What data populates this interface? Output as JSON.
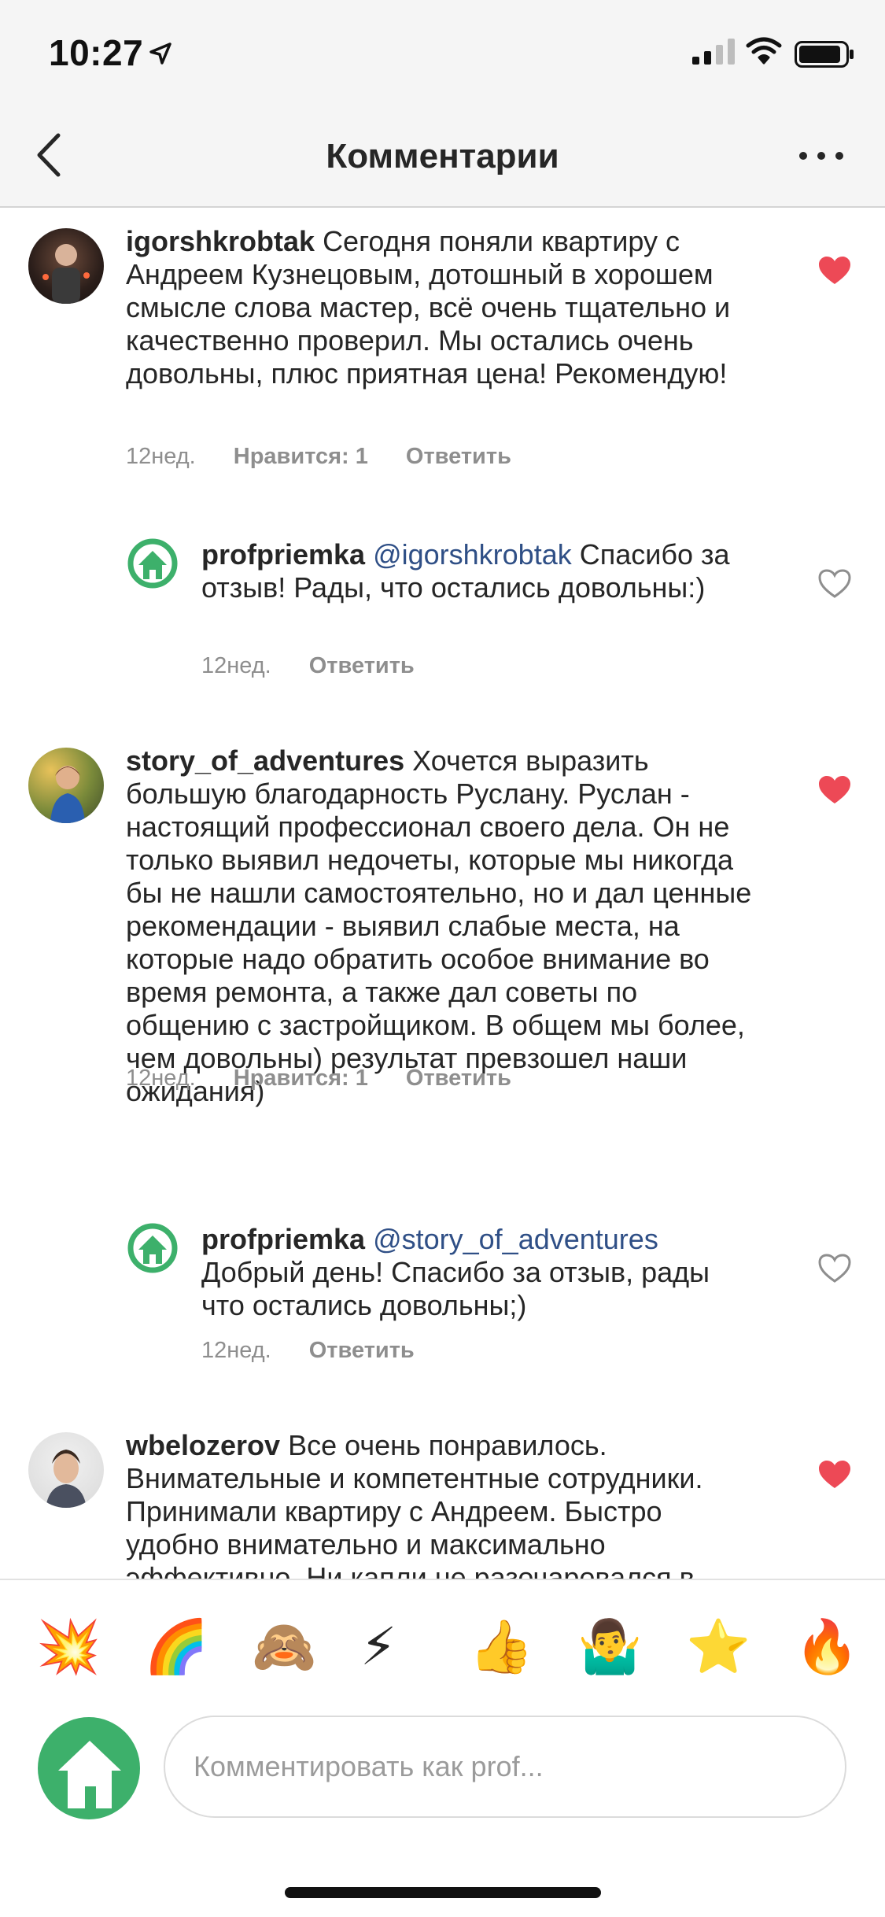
{
  "status_bar": {
    "time": "10:27"
  },
  "header": {
    "title": "Комментарии"
  },
  "comments": [
    {
      "username": "igorshkrobtak",
      "text": "Сегодня поняли квартиру с Андреем Кузнецовым, дотошный в хорошем смысле слова мастер, всё очень тщательно и качественно проверил. Мы остались очень довольны, плюс приятная цена! Рекомендую!",
      "time": "12нед.",
      "likes": "Нравится: 1",
      "reply": "Ответить",
      "liked": true,
      "reply_comment": {
        "username": "profpriemka",
        "mention": "@igorshkrobtak",
        "text": "Спасибо за отзыв! Рады, что остались довольны:)",
        "time": "12нед.",
        "reply": "Ответить",
        "liked": false
      }
    },
    {
      "username": "story_of_adventures",
      "text": "Хочется выразить большую благодарность Руслану. Руслан - настоящий профессионал своего дела. Он не только выявил недочеты, которые мы никогда бы не нашли самостоятельно, но и дал ценные рекомендации - выявил слабые места, на которые надо обратить особое внимание во время ремонта, а также дал советы по общению с застройщиком. В общем мы более, чем довольны) результат превзошел наши ожидания)",
      "time": "12нед.",
      "likes": "Нравится: 1",
      "reply": "Ответить",
      "liked": true,
      "reply_comment": {
        "username": "profpriemka",
        "mention": "@story_of_adventures",
        "text": "Добрый день! Спасибо за отзыв, рады что остались довольны;)",
        "time": "12нед.",
        "reply": "Ответить",
        "liked": false
      }
    },
    {
      "username": "wbelozerov",
      "text": "Все очень понравилось. Внимательные и компетентные сотрудники. Принимали квартиру с Андреем. Быстро удобно внимательно и максимально эффективно. Ни капли не разочаровался в",
      "liked": true
    }
  ],
  "reactions": [
    "💥",
    "🌈",
    "🙈",
    "⚡",
    "👍",
    "🤷‍♂️",
    "⭐",
    "🔥"
  ],
  "composer": {
    "placeholder": "Комментировать как prof..."
  },
  "colors": {
    "like_red": "#ed4956",
    "brand_green": "#3db06b",
    "mention_blue": "#2f4f86"
  }
}
